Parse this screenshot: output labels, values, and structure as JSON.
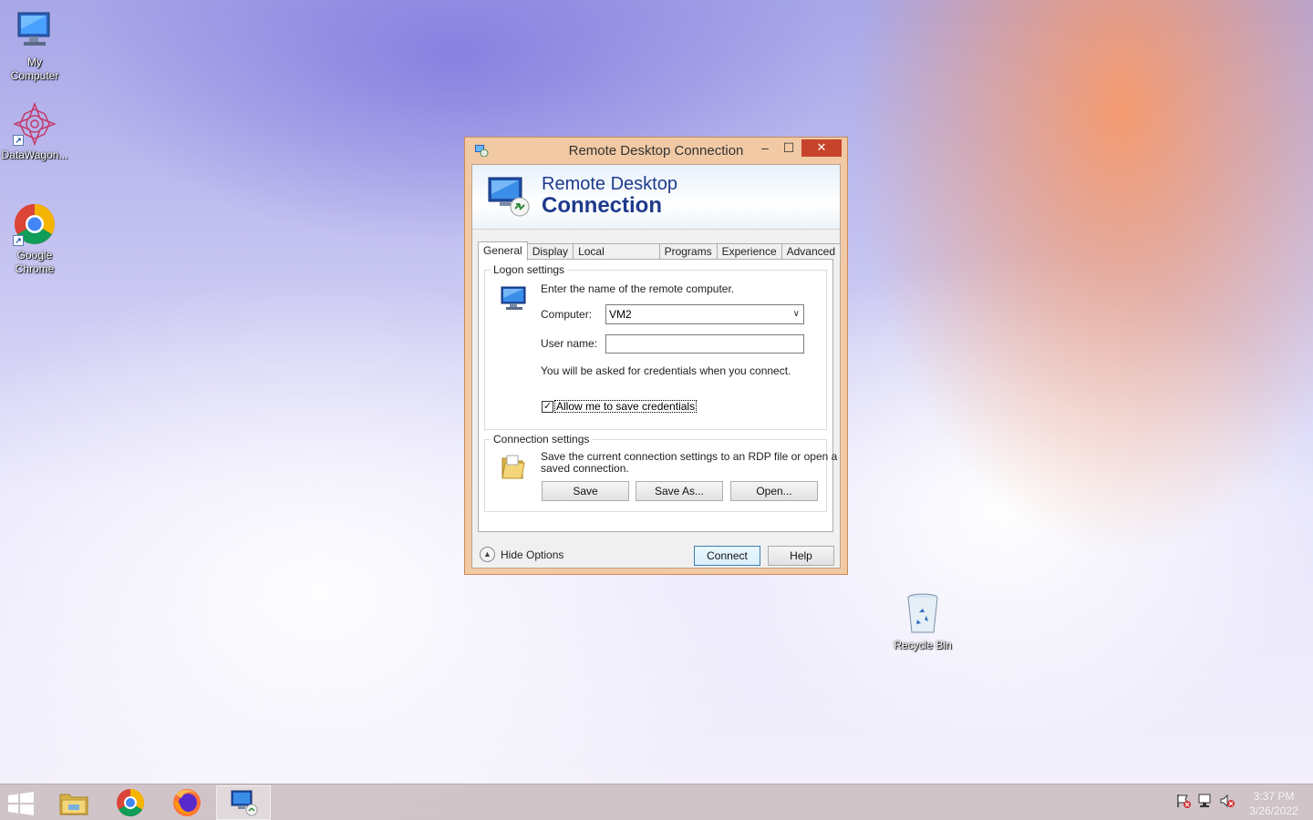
{
  "desktop": {
    "icons": [
      {
        "label": "My\nComputer",
        "line1": "My",
        "line2": "Computer"
      },
      {
        "label": "DataWagon...",
        "line1": "DataWagon...",
        "line2": ""
      },
      {
        "label": "Google Chrome",
        "line1": "Google",
        "line2": "Chrome"
      },
      {
        "label": "Recycle Bin",
        "line1": "Recycle Bin",
        "line2": ""
      }
    ]
  },
  "window": {
    "title": "Remote Desktop Connection",
    "controls": {
      "minimize": "–",
      "maximize": "☐",
      "close": "✕"
    },
    "banner": {
      "line1": "Remote Desktop",
      "line2": "Connection"
    },
    "tabs": [
      "General",
      "Display",
      "Local Resources",
      "Programs",
      "Experience",
      "Advanced"
    ],
    "active_tab": "General",
    "logon": {
      "legend": "Logon settings",
      "instruction": "Enter the name of the remote computer.",
      "computer_label": "Computer:",
      "computer_value": "VM2",
      "username_label": "User name:",
      "username_value": "",
      "credentials_note": "You will be asked for credentials when you connect.",
      "save_credentials_label": "Allow me to save credentials",
      "save_credentials_checked": true
    },
    "connection": {
      "legend": "Connection settings",
      "description_line1": "Save the current connection settings to an RDP file or open a",
      "description_line2": "saved connection.",
      "save": "Save",
      "save_as": "Save As...",
      "open": "Open..."
    },
    "footer": {
      "hide_options": "Hide Options",
      "connect": "Connect",
      "help": "Help"
    }
  },
  "taskbar": {
    "apps": [
      "File Explorer",
      "Google Chrome",
      "Firefox",
      "Remote Desktop Connection"
    ],
    "tray_icons": [
      "action-center-icon",
      "network-icon",
      "volume-muted-icon"
    ],
    "time": "3:37 PM",
    "date": "3/26/2022"
  }
}
